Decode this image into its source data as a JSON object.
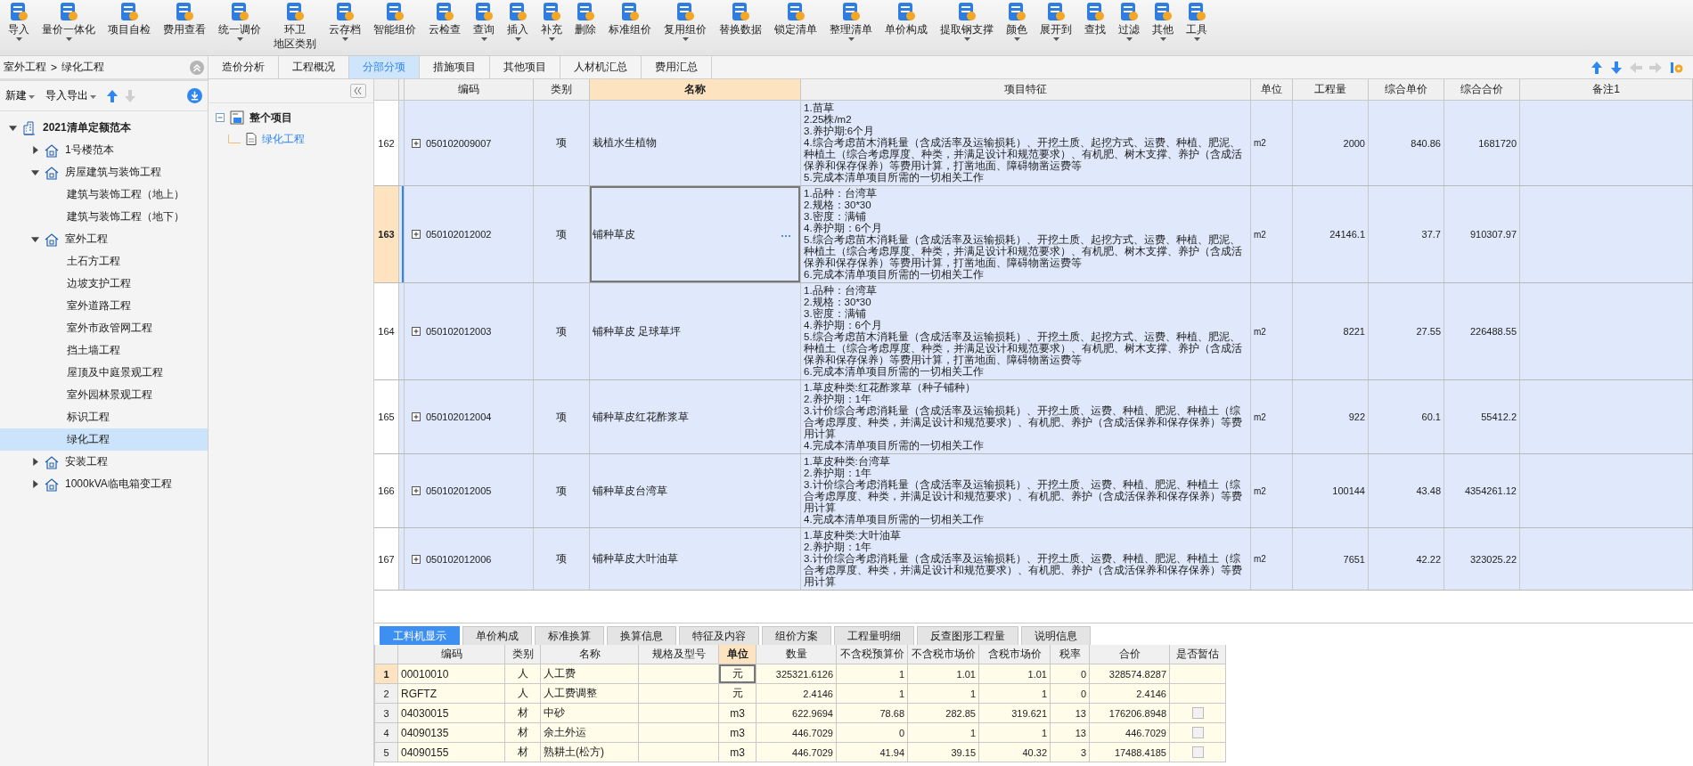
{
  "toolbar": [
    {
      "label": "导入",
      "dropdown": true
    },
    {
      "label": "量价一体化",
      "dropdown": true
    },
    {
      "label": "项目自检",
      "dropdown": false
    },
    {
      "label": "费用查看",
      "dropdown": false
    },
    {
      "label": "统一调价",
      "dropdown": true
    },
    {
      "label": "环卫",
      "sublabel": "地区类别",
      "dropdown": false
    },
    {
      "label": "云存档",
      "dropdown": true
    },
    {
      "label": "智能组价",
      "dropdown": false
    },
    {
      "label": "云检查",
      "dropdown": false
    },
    {
      "label": "查询",
      "dropdown": true
    },
    {
      "label": "插入",
      "dropdown": true
    },
    {
      "label": "补充",
      "dropdown": true
    },
    {
      "label": "删除",
      "dropdown": false
    },
    {
      "label": "标准组价",
      "dropdown": false
    },
    {
      "label": "复用组价",
      "dropdown": true
    },
    {
      "label": "替换数据",
      "dropdown": false
    },
    {
      "label": "锁定清单",
      "dropdown": false
    },
    {
      "label": "整理清单",
      "dropdown": true
    },
    {
      "label": "单价构成",
      "dropdown": false
    },
    {
      "label": "提取钢支撑",
      "dropdown": true
    },
    {
      "label": "颜色",
      "dropdown": true
    },
    {
      "label": "展开到",
      "dropdown": true
    },
    {
      "label": "查找",
      "dropdown": false
    },
    {
      "label": "过滤",
      "dropdown": true
    },
    {
      "label": "其他",
      "dropdown": true
    },
    {
      "label": "工具",
      "dropdown": true
    }
  ],
  "left_panel": {
    "breadcrumb": [
      "室外工程",
      ">",
      "绿化工程"
    ],
    "actions": [
      {
        "label": "新建",
        "dropdown": true
      },
      {
        "label": "导入导出",
        "dropdown": true
      }
    ],
    "move_buttons": [
      {
        "kind": "up",
        "disabled": false
      },
      {
        "kind": "down",
        "disabled": true
      }
    ],
    "tree": [
      {
        "label": "2021清单定额范本",
        "expanded": true,
        "selected": false,
        "children": [
          {
            "label": "1号楼范本",
            "expanded": false,
            "selected": false
          },
          {
            "label": "房屋建筑与装饰工程",
            "expanded": true,
            "selected": false,
            "children": [
              {
                "label": "建筑与装饰工程（地上）",
                "selected": false
              },
              {
                "label": "建筑与装饰工程（地下）",
                "selected": false
              }
            ]
          },
          {
            "label": "室外工程",
            "expanded": true,
            "selected": false,
            "children": [
              {
                "label": "土石方工程",
                "selected": false
              },
              {
                "label": "边坡支护工程",
                "selected": false
              },
              {
                "label": "室外道路工程",
                "selected": false
              },
              {
                "label": "室外市政管网工程",
                "selected": false
              },
              {
                "label": "挡土墙工程",
                "selected": false
              },
              {
                "label": "屋顶及中庭景观工程",
                "selected": false
              },
              {
                "label": "室外园林景观工程",
                "selected": false
              },
              {
                "label": "标识工程",
                "selected": false
              },
              {
                "label": "绿化工程",
                "selected": true
              }
            ]
          },
          {
            "label": "安装工程",
            "expanded": false,
            "selected": false
          },
          {
            "label": "1000kVA临电箱变工程",
            "expanded": false,
            "selected": false
          }
        ]
      }
    ]
  },
  "middle_panel": {
    "tree": [
      {
        "label": "整个项目",
        "expanded": true,
        "selected": false,
        "children": [
          {
            "label": "绿化工程",
            "selected": true
          }
        ]
      }
    ]
  },
  "tabs": [
    {
      "label": "造价分析",
      "selected": false
    },
    {
      "label": "工程概况",
      "selected": false
    },
    {
      "label": "分部分项",
      "selected": true
    },
    {
      "label": "措施项目",
      "selected": false
    },
    {
      "label": "其他项目",
      "selected": false
    },
    {
      "label": "人材机汇总",
      "selected": false
    },
    {
      "label": "费用汇总",
      "selected": false
    }
  ],
  "nav_buttons": [
    {
      "kind": "up",
      "disabled": false
    },
    {
      "kind": "down",
      "disabled": false
    },
    {
      "kind": "left",
      "disabled": true
    },
    {
      "kind": "right",
      "disabled": true
    }
  ],
  "grid": {
    "columns": [
      {
        "label": "编码",
        "highlighted": false
      },
      {
        "label": "类别",
        "highlighted": false
      },
      {
        "label": "名称",
        "highlighted": true
      },
      {
        "label": "项目特征",
        "highlighted": false
      },
      {
        "label": "单位",
        "highlighted": false
      },
      {
        "label": "工程量",
        "highlighted": false
      },
      {
        "label": "综合单价",
        "highlighted": false
      },
      {
        "label": "综合合价",
        "highlighted": false
      },
      {
        "label": "备注1",
        "highlighted": false
      }
    ],
    "rows": [
      {
        "number": "162",
        "code": "050102009007",
        "category": "项",
        "name": "栽植水生植物",
        "features": [
          "1.苗草",
          "2.25株/m2",
          "3.养护期:6个月",
          "4.综合考虑苗木消耗量（含成活率及运输损耗）、开挖土质、起挖方式、运费、种植、肥泥、种植土（综合考虑厚度、种类，并满足设计和规范要求）、有机肥、树木支撑、养护（含成活保养和保存保养）等费用计算，打凿地面、障碍物凿运费等",
          "5.完成本清单项目所需的一切相关工作"
        ],
        "unit": "m2",
        "quantity": "2000",
        "unit_price": "840.86",
        "total": "1681720",
        "selected": false
      },
      {
        "number": "163",
        "code": "050102012002",
        "category": "项",
        "name": "铺种草皮",
        "features": [
          "1.品种：台湾草",
          "2.规格：30*30",
          "3.密度：满铺",
          "4.养护期：6个月",
          "5.综合考虑苗木消耗量（含成活率及运输损耗）、开挖土质、起挖方式、运费、种植、肥泥、种植土（综合考虑厚度、种类，并满足设计和规范要求）、有机肥、树木支撑、养护（含成活保养和保存保养）等费用计算，打凿地面、障碍物凿运费等",
          "6.完成本清单项目所需的一切相关工作"
        ],
        "unit": "m2",
        "quantity": "24146.1",
        "unit_price": "37.7",
        "total": "910307.97",
        "selected": true
      },
      {
        "number": "164",
        "code": "050102012003",
        "category": "项",
        "name": "铺种草皮 足球草坪",
        "features": [
          "1.品种：台湾草",
          "2.规格：30*30",
          "3.密度：满铺",
          "4.养护期：6个月",
          "5.综合考虑苗木消耗量（含成活率及运输损耗）、开挖土质、起挖方式、运费、种植、肥泥、种植土（综合考虑厚度、种类，并满足设计和规范要求）、有机肥、树木支撑、养护（含成活保养和保存保养）等费用计算，打凿地面、障碍物凿运费等",
          "6.完成本清单项目所需的一切相关工作"
        ],
        "unit": "m2",
        "quantity": "8221",
        "unit_price": "27.55",
        "total": "226488.55",
        "selected": false
      },
      {
        "number": "165",
        "code": "050102012004",
        "category": "项",
        "name": "铺种草皮红花酢浆草",
        "features": [
          "1.草皮种类:红花酢浆草（种子铺种）",
          "2.养护期：1年",
          "3.计价综合考虑消耗量（含成活率及运输损耗）、开挖土质、运费、种植、肥泥、种植土（综合考虑厚度、种类，并满足设计和规范要求）、有机肥、养护（含成活保养和保存保养）等费用计算",
          "4.完成本清单项目所需的一切相关工作"
        ],
        "unit": "m2",
        "quantity": "922",
        "unit_price": "60.1",
        "total": "55412.2",
        "selected": false
      },
      {
        "number": "166",
        "code": "050102012005",
        "category": "项",
        "name": "铺种草皮台湾草",
        "features": [
          "1.草皮种类:台湾草",
          "2.养护期：1年",
          "3.计价综合考虑消耗量（含成活率及运输损耗）、开挖土质、运费、种植、肥泥、种植土（综合考虑厚度、种类，并满足设计和规范要求）、有机肥、养护（含成活保养和保存保养）等费用计算",
          "4.完成本清单项目所需的一切相关工作"
        ],
        "unit": "m2",
        "quantity": "100144",
        "unit_price": "43.48",
        "total": "4354261.12",
        "selected": false
      },
      {
        "number": "167",
        "code": "050102012006",
        "category": "项",
        "name": "铺种草皮大叶油草",
        "features": [
          "1.草皮种类:大叶油草",
          "2.养护期：1年",
          "3.计价综合考虑消耗量（含成活率及运输损耗）、开挖土质、运费、种植、肥泥、种植土（综合考虑厚度、种类，并满足设计和规范要求）、有机肥、养护（含成活保养和保存保养）等费用计算"
        ],
        "unit": "m2",
        "quantity": "7651",
        "unit_price": "42.22",
        "total": "323025.22",
        "selected": false
      }
    ]
  },
  "bottom_tabs": [
    {
      "label": "工料机显示",
      "selected": true
    },
    {
      "label": "单价构成",
      "selected": false
    },
    {
      "label": "标准换算",
      "selected": false
    },
    {
      "label": "换算信息",
      "selected": false
    },
    {
      "label": "特征及内容",
      "selected": false
    },
    {
      "label": "组价方案",
      "selected": false
    },
    {
      "label": "工程量明细",
      "selected": false
    },
    {
      "label": "反查图形工程量",
      "selected": false
    },
    {
      "label": "说明信息",
      "selected": false
    }
  ],
  "resource_grid": {
    "columns": [
      {
        "label": "编码",
        "highlighted": false
      },
      {
        "label": "类别",
        "highlighted": false
      },
      {
        "label": "名称",
        "highlighted": false
      },
      {
        "label": "规格及型号",
        "highlighted": false
      },
      {
        "label": "单位",
        "highlighted": true
      },
      {
        "label": "数量",
        "highlighted": false
      },
      {
        "label": "不含税预算价",
        "highlighted": false
      },
      {
        "label": "不含税市场价",
        "highlighted": false
      },
      {
        "label": "含税市场价",
        "highlighted": false
      },
      {
        "label": "税率",
        "highlighted": false
      },
      {
        "label": "合价",
        "highlighted": false
      },
      {
        "label": "是否暂估",
        "highlighted": false
      }
    ],
    "rows": [
      {
        "number": "1",
        "selected": true,
        "code": "00010010",
        "category": "人",
        "name": "人工费",
        "unit": "元",
        "quantity": "325321.6126",
        "budget_price": "1",
        "market_price": "1.01",
        "tax_market_price": "1.01",
        "tax_rate": "0",
        "total": "328574.8287"
      },
      {
        "number": "2",
        "selected": false,
        "code": "RGFTZ",
        "category": "人",
        "name": "人工费调整",
        "unit": "元",
        "quantity": "2.4146",
        "budget_price": "1",
        "market_price": "1",
        "tax_market_price": "1",
        "tax_rate": "0",
        "total": "2.4146"
      },
      {
        "number": "3",
        "selected": false,
        "code": "04030015",
        "category": "材",
        "name": "中砂",
        "unit": "m3",
        "quantity": "622.9694",
        "budget_price": "78.68",
        "market_price": "282.85",
        "tax_market_price": "319.621",
        "tax_rate": "13",
        "total": "176206.8948",
        "estimate_checked": false
      },
      {
        "number": "4",
        "selected": false,
        "code": "04090135",
        "category": "材",
        "name": "余土外运",
        "unit": "m3",
        "quantity": "446.7029",
        "budget_price": "0",
        "market_price": "1",
        "tax_market_price": "1",
        "tax_rate": "13",
        "total": "446.7029",
        "estimate_checked": false
      },
      {
        "number": "5",
        "selected": false,
        "code": "04090155",
        "category": "材",
        "name": "熟耕土(松方)",
        "unit": "m3",
        "quantity": "446.7029",
        "budget_price": "41.94",
        "market_price": "39.15",
        "tax_market_price": "40.32",
        "tax_rate": "3",
        "total": "17488.4185",
        "estimate_checked": false
      }
    ]
  }
}
